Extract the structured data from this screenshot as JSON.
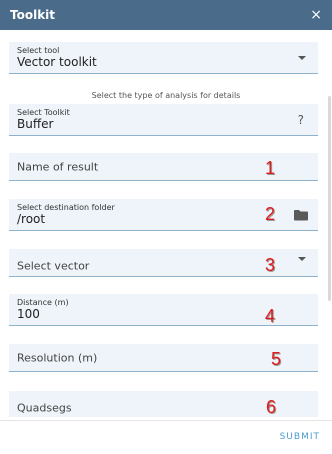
{
  "header": {
    "title": "Toolkit",
    "close_icon": "×"
  },
  "select_tool": {
    "label": "Select tool",
    "value": "Vector toolkit"
  },
  "hint_text": "Select the type of analysis for details",
  "select_toolkit": {
    "label": "Select Toolkit",
    "value": "Buffer",
    "help_icon": "?"
  },
  "name_of_result": {
    "placeholder": "Name of result",
    "marker": "1"
  },
  "destination_folder": {
    "label": "Select destination folder",
    "value": "/root",
    "marker": "2"
  },
  "select_vector": {
    "placeholder": "Select vector",
    "marker": "3"
  },
  "distance": {
    "label": "Distance (m)",
    "value": "100",
    "marker": "4"
  },
  "resolution": {
    "placeholder": "Resolution (m)",
    "marker": "5"
  },
  "quadsegs": {
    "placeholder": "Quadsegs",
    "marker": "6"
  },
  "footer": {
    "submit_label": "SUBMIT"
  },
  "colors": {
    "header_bg": "#4a6b89",
    "field_bg": "#eef4f9",
    "field_underline": "#8fb2cc",
    "accent": "#4e9bd1",
    "marker_red": "#e01b1b"
  },
  "icons": [
    "close-icon",
    "dropdown-caret-icon",
    "help-icon",
    "folder-icon"
  ]
}
